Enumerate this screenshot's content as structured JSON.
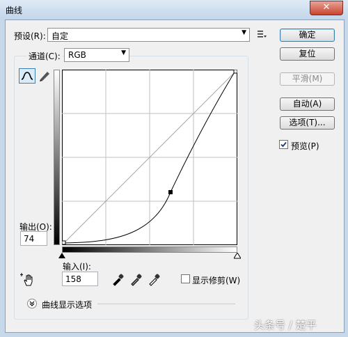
{
  "window": {
    "title": "曲线",
    "close_glyph": "✕"
  },
  "preset": {
    "label": "预设(R):",
    "value": "自定"
  },
  "channel": {
    "label": "通道(C):",
    "value": "RGB"
  },
  "buttons": {
    "ok": "确定",
    "reset": "复位",
    "smooth": "平滑(M)",
    "auto": "自动(A)",
    "options": "选项(T)..."
  },
  "preview": {
    "label": "预览(P)",
    "checked": true
  },
  "output": {
    "label": "输出(O):",
    "value": "74"
  },
  "input": {
    "label": "输入(I):",
    "value": "158"
  },
  "show_clipping": {
    "label": "显示修剪(W)",
    "checked": false
  },
  "curve_options": {
    "label": "曲线显示选项"
  },
  "icons": {
    "preset_menu": "list-menu-icon",
    "curve_tool": "curve-tool-icon",
    "pencil_tool": "pencil-icon",
    "hand_tool": "target-adjust-hand-icon",
    "black_eyedropper": "eyedropper-black-icon",
    "gray_eyedropper": "eyedropper-gray-icon",
    "white_eyedropper": "eyedropper-white-icon",
    "expand": "expand-chevron-icon"
  },
  "watermark": "头条号 / 楚平",
  "colors": {
    "accent": "#3c7fb1",
    "title_bar": "#c4d6ea",
    "close": "#c8452f"
  }
}
